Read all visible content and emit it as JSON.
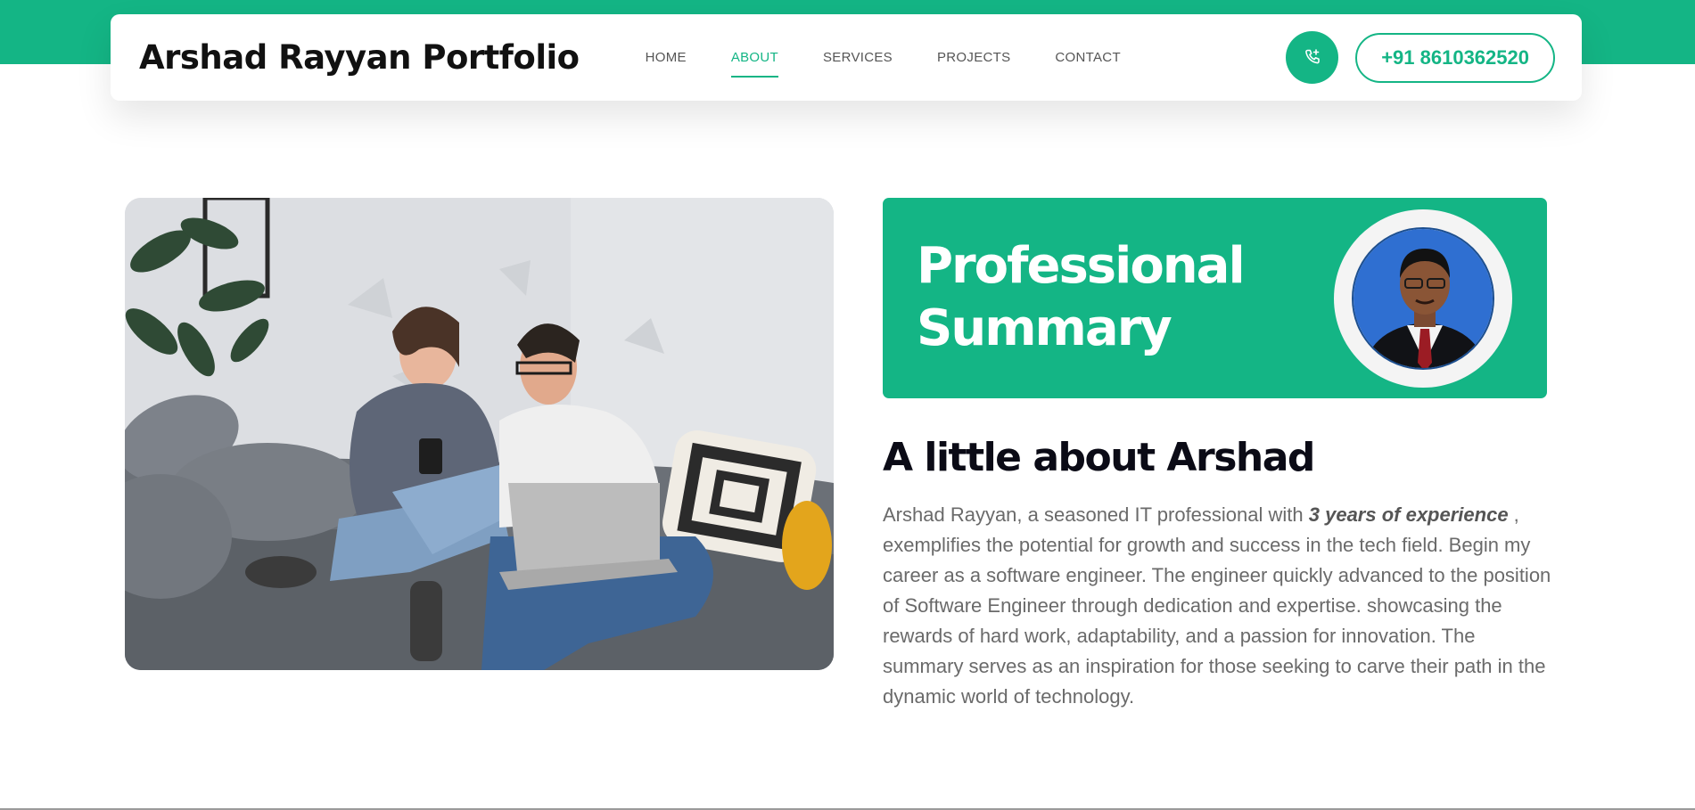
{
  "header": {
    "brand": "Arshad Rayyan Portfolio",
    "nav": [
      {
        "label": "HOME",
        "active": false
      },
      {
        "label": "ABOUT",
        "active": true
      },
      {
        "label": "SERVICES",
        "active": false
      },
      {
        "label": "PROJECTS",
        "active": false
      },
      {
        "label": "CONTACT",
        "active": false
      }
    ],
    "phone_icon": "phone-plus-icon",
    "phone_number": "+91 8610362520"
  },
  "photo": {
    "subject": "couple-on-sofa-photo"
  },
  "summary": {
    "title_line1": "Professional",
    "title_line2": "Summary",
    "avatar": "profile-photo"
  },
  "about": {
    "heading": "A little about Arshad",
    "para_before": "Arshad Rayyan, a seasoned IT professional with ",
    "para_emphasis": "3 years of experience ",
    "para_after": ", exemplifies the potential for growth and success in the tech field. Begin my career as a software engineer. The engineer quickly advanced to the position of Software Engineer through dedication and expertise. showcasing the rewards of hard work, adaptability, and a passion for innovation. The summary serves as an inspiration for those seeking to carve their path in the dynamic world of technology."
  },
  "colors": {
    "accent": "#14b585",
    "text_dark": "#0b0b16",
    "text_muted": "#6a6a6a"
  }
}
